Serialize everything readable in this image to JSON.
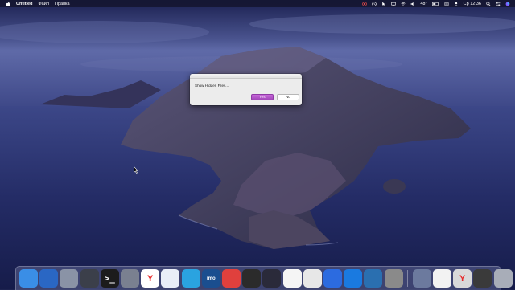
{
  "menubar": {
    "app_name": "Untitled",
    "menus": [
      "Файл",
      "Правка"
    ],
    "battery": "48°",
    "clock": "Ср 12:36",
    "status_icons": [
      "record-icon",
      "clock-icon",
      "cursor-icon",
      "display-icon",
      "wifi-icon",
      "volume-icon",
      "battery-icon",
      "keyboard-icon",
      "user-icon",
      "search-icon",
      "control-center-icon",
      "siri-icon"
    ]
  },
  "dialog": {
    "message": "Show Hidden Files...",
    "yes_label": "Yes",
    "no_label": "No",
    "accent": "#b855cc"
  },
  "dock": {
    "apps": [
      {
        "name": "finder-icon",
        "glyph": "",
        "bg": "#3a8ee6"
      },
      {
        "name": "activity-monitor-icon",
        "glyph": "",
        "bg": "#2a67c4"
      },
      {
        "name": "launchpad-icon",
        "glyph": "",
        "bg": "#8a93a6"
      },
      {
        "name": "mission-control-icon",
        "glyph": "",
        "bg": "#3b3f4a"
      },
      {
        "name": "terminal-icon",
        "glyph": ">_",
        "bg": "#1c1c1c"
      },
      {
        "name": "archive-utility-icon",
        "glyph": "",
        "bg": "#7a8090"
      },
      {
        "name": "yandex-browser-icon",
        "glyph": "Y",
        "bg": "#ffffff"
      },
      {
        "name": "safari-icon",
        "glyph": "",
        "bg": "#e9eef7"
      },
      {
        "name": "telegram-icon",
        "glyph": "",
        "bg": "#2aa3e0"
      },
      {
        "name": "imo-icon",
        "glyph": "imo",
        "bg": "#1a4e8f"
      },
      {
        "name": "anydesk-icon",
        "glyph": "",
        "bg": "#e0403d"
      },
      {
        "name": "obs-icon",
        "glyph": "",
        "bg": "#2b2b2b"
      },
      {
        "name": "final-cut-pro-icon",
        "glyph": "",
        "bg": "#2a2a3a"
      },
      {
        "name": "photos-icon",
        "glyph": "",
        "bg": "#f5f5f5"
      },
      {
        "name": "keynote-icon",
        "glyph": "",
        "bg": "#e7e7e7"
      },
      {
        "name": "compressor-icon",
        "glyph": "",
        "bg": "#2c6be0"
      },
      {
        "name": "xcode-icon",
        "glyph": "",
        "bg": "#1a7ae0"
      },
      {
        "name": "quicktime-icon",
        "glyph": "",
        "bg": "#2a6fb0"
      },
      {
        "name": "system-preferences-icon",
        "glyph": "",
        "bg": "#8a8a8a"
      },
      {
        "name": "stacks-icon",
        "glyph": "",
        "bg": "#6c7a9e"
      },
      {
        "name": "document-icon",
        "glyph": "",
        "bg": "#f2f2f2"
      },
      {
        "name": "yandex-window-icon",
        "glyph": "Y",
        "bg": "#d9d9d9"
      },
      {
        "name": "minimized-window-icon",
        "glyph": "",
        "bg": "#3a3a3a"
      },
      {
        "name": "trash-icon",
        "glyph": "",
        "bg": "#a8adb8"
      }
    ]
  }
}
